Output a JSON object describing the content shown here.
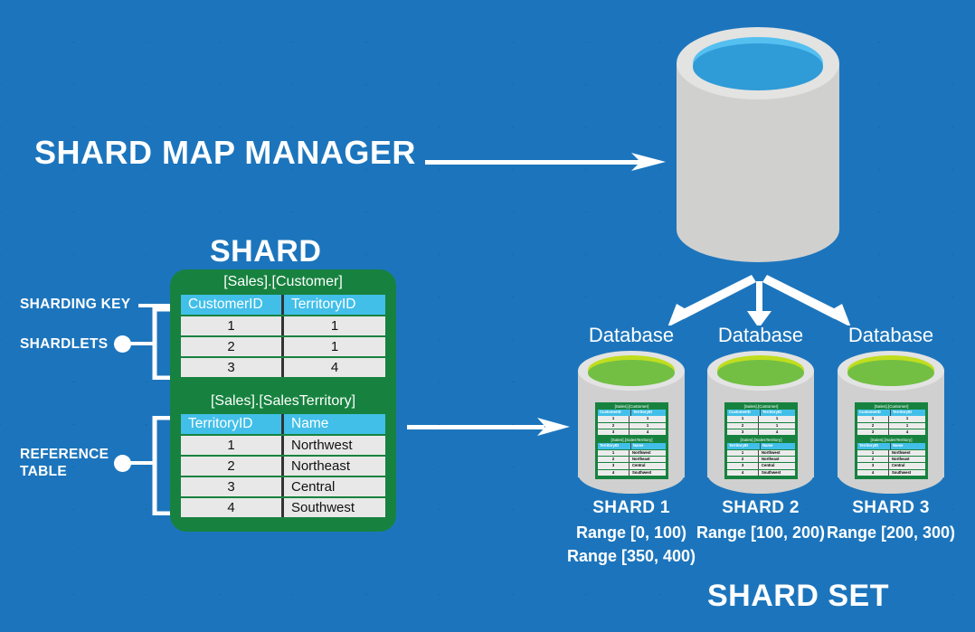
{
  "headings": {
    "shard_map_manager": "SHARD MAP MANAGER",
    "shard": "SHARD",
    "shard_set": "SHARD SET"
  },
  "side_labels": {
    "sharding_key": "SHARDING KEY",
    "shardlets": "SHARDLETS",
    "reference_table_line1": "REFERENCE",
    "reference_table_line2": "TABLE"
  },
  "shard_card": {
    "customer_table": {
      "title": "[Sales].[Customer]",
      "columns": [
        "CustomerID",
        "TerritoryID"
      ],
      "rows": [
        [
          "1",
          "1"
        ],
        [
          "2",
          "1"
        ],
        [
          "3",
          "4"
        ]
      ]
    },
    "salesterritory_table": {
      "title": "[Sales].[SalesTerritory]",
      "columns": [
        "TerritoryID",
        "Name"
      ],
      "rows": [
        [
          "1",
          "Northwest"
        ],
        [
          "2",
          "Northeast"
        ],
        [
          "3",
          "Central"
        ],
        [
          "4",
          "Southwest"
        ]
      ]
    }
  },
  "shards": [
    {
      "db_label": "Database",
      "name": "SHARD 1",
      "ranges": "Range [0, 100)\nRange [350, 400)"
    },
    {
      "db_label": "Database",
      "name": "SHARD 2",
      "ranges": "Range [100, 200)"
    },
    {
      "db_label": "Database",
      "name": "SHARD 3",
      "ranges": "Range [200, 300)"
    }
  ],
  "icons": {
    "shard_map_db": "database-cylinder-icon",
    "shard_db": "database-cylinder-green-icon",
    "arrow_right": "arrow-right-icon",
    "arrow_fanout": "arrow-fanout-icon",
    "bullet": "bullet-dot-icon"
  },
  "colors": {
    "background": "#1c75bc",
    "card_green": "#17823f",
    "header_cyan": "#41bfe9",
    "row_gray": "#e8e8e8",
    "cylinder_gray": "#cfd0cf",
    "cylinder_top_blue": "#2f9bd7",
    "cylinder_top_green": "#72bf44",
    "white": "#ffffff"
  }
}
